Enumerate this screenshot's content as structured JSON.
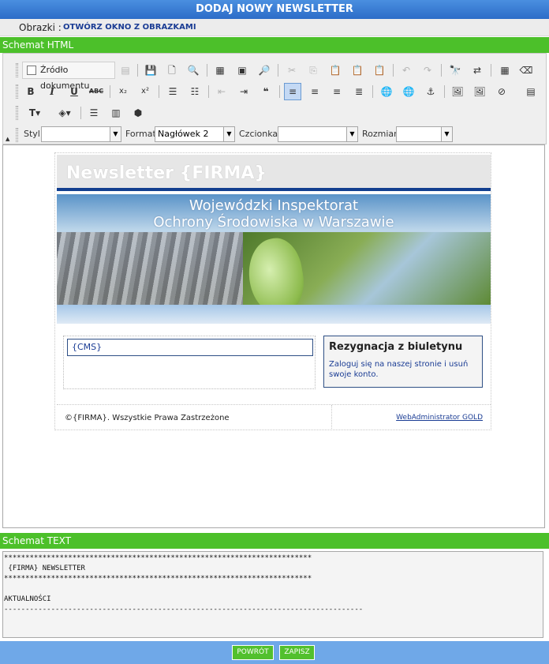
{
  "header": {
    "title": "DODAJ NOWY NEWSLETTER"
  },
  "images": {
    "label": "Obrazki :",
    "link": "OTWÓRZ OKNO Z OBRAZKAMI"
  },
  "html_section": {
    "title": "Schemat HTML"
  },
  "toolbar": {
    "source_label": "Źródło dokumentu",
    "style_label": "Styl",
    "style_value": "",
    "format_label": "Format",
    "format_value": "Nagłówek 2",
    "font_label": "Czcionka",
    "font_value": "",
    "size_label": "Rozmiar",
    "size_value": ""
  },
  "newsletter": {
    "title": "Newsletter {FIRMA}",
    "banner_line1": "Wojewódzki Inspektorat",
    "banner_line2": "Ochrony Środowiska w Warszawie",
    "cms_placeholder": "{CMS}",
    "side_title": "Rezygnacja z biuletynu",
    "side_text": "Zaloguj się na naszej stronie i usuń swoje konto.",
    "footer_left": "©{FIRMA}. Wszystkie Prawa Zastrzeżone",
    "footer_right": "WebAdministrator GOLD"
  },
  "text_section": {
    "title": "Schemat TEXT",
    "content": "************************************************************************\n {FIRMA} NEWSLETTER\n************************************************************************\n\nAKTUALNOŚCI\n------------------------------------------------------------------------------------"
  },
  "buttons": {
    "back": "POWRÓT",
    "save": "ZAPISZ"
  },
  "colors": {
    "green": "#4cc02a",
    "blue_header": "#2c6cc8",
    "bottom_bar": "#6fa8e8"
  }
}
